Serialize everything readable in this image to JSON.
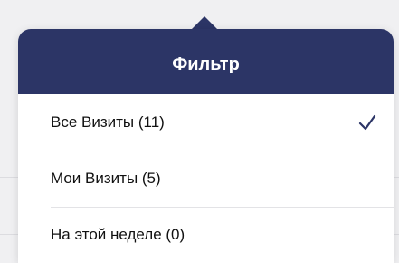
{
  "filter_popover": {
    "title": "Фильтр",
    "options": [
      {
        "label": "Все Визиты (11)",
        "selected": true
      },
      {
        "label": "Мои Визиты (5)",
        "selected": false
      },
      {
        "label": "На этой неделе (0)",
        "selected": false
      }
    ],
    "colors": {
      "header_background": "#2c3566",
      "header_text": "#ffffff",
      "checkmark": "#2c3566"
    },
    "icons": {
      "selected_indicator": "checkmark-icon"
    }
  }
}
